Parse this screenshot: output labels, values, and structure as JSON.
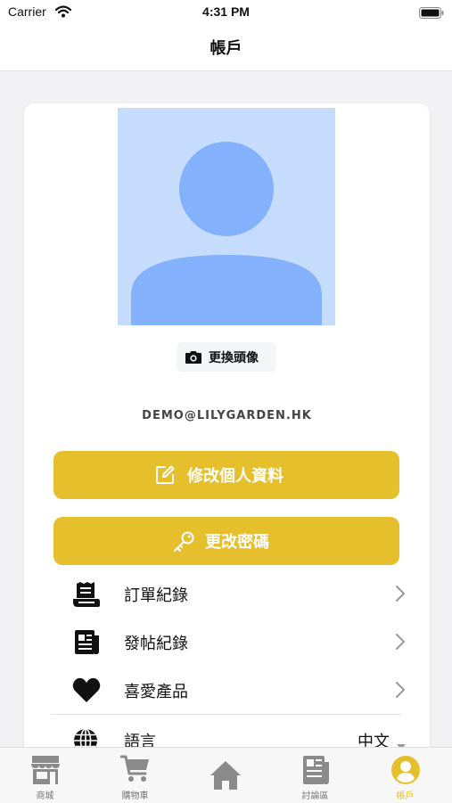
{
  "status_bar": {
    "carrier": "Carrier",
    "time": "4:31 PM"
  },
  "nav": {
    "title": "帳戶"
  },
  "profile": {
    "change_avatar_label": "更換頭像",
    "email": "DEMO@LILYGARDEN.HK"
  },
  "buttons": {
    "edit_profile": "修改個人資料",
    "change_password": "更改密碼"
  },
  "menu": {
    "orders": "訂單紀錄",
    "posts": "發帖紀錄",
    "favorites": "喜愛產品",
    "language": "語言",
    "language_value": "中文"
  },
  "tabs": [
    {
      "label": "商城",
      "icon": "store-icon"
    },
    {
      "label": "購物車",
      "icon": "cart-icon"
    },
    {
      "label": "",
      "icon": "home-icon"
    },
    {
      "label": "討論區",
      "icon": "newspaper-icon"
    },
    {
      "label": "帳戶",
      "icon": "user-circle-icon",
      "active": true
    }
  ],
  "colors": {
    "accent": "#e6bf2c",
    "avatar_bg": "#c6dcfd",
    "avatar_fg": "#83b1fb",
    "tab_inactive": "#8a8a8a"
  }
}
